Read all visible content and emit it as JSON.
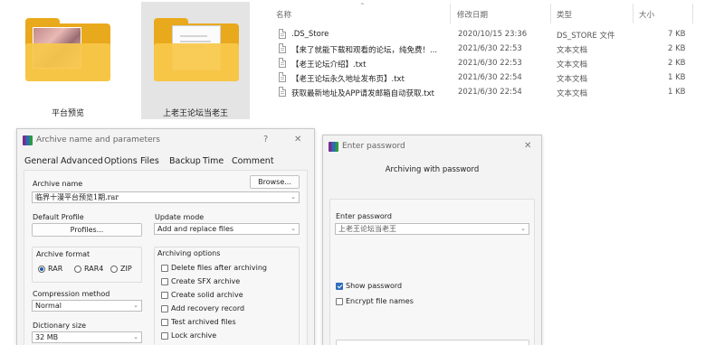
{
  "explorer": {
    "columns": {
      "name": "名称",
      "modified": "修改日期",
      "type": "类型",
      "size": "大小"
    },
    "files": [
      {
        "name": ".DS_Store",
        "date": "2020/10/15 23:36",
        "type": "DS_STORE 文件",
        "size": "7 KB"
      },
      {
        "name": "【来了就能下载和观看的论坛，纯免费！...",
        "date": "2021/6/30 22:53",
        "type": "文本文档",
        "size": "2 KB"
      },
      {
        "name": "【老王论坛介绍】.txt",
        "date": "2021/6/30 22:53",
        "type": "文本文档",
        "size": "2 KB"
      },
      {
        "name": "【老王论坛永久地址发布页】.txt",
        "date": "2021/6/30 22:54",
        "type": "文本文档",
        "size": "1 KB"
      },
      {
        "name": "获取最新地址及APP请发邮箱自动获取.txt",
        "date": "2021/6/30 22:54",
        "type": "文本文档",
        "size": "1 KB"
      }
    ]
  },
  "folders": [
    {
      "label": "平台预览"
    },
    {
      "label": "上老王论坛当老王"
    }
  ],
  "archive_dialog": {
    "title": "Archive name and parameters",
    "help": "?",
    "close": "✕",
    "tabs": [
      "General",
      "Advanced",
      "Options",
      "Files",
      "Backup",
      "Time",
      "Comment"
    ],
    "archive_name_label": "Archive name",
    "browse_label": "Browse...",
    "archive_name_value": "临界十漫平台预览1期.rar",
    "default_profile_label": "Default Profile",
    "profiles_label": "Profiles...",
    "update_mode_label": "Update mode",
    "update_mode_value": "Add and replace files",
    "archive_format_label": "Archive format",
    "formats": [
      "RAR",
      "RAR4",
      "ZIP"
    ],
    "selected_format": "RAR",
    "compression_method_label": "Compression method",
    "compression_method_value": "Normal",
    "dictionary_size_label": "Dictionary size",
    "dictionary_size_value": "32 MB",
    "archiving_options_label": "Archiving options",
    "options": [
      {
        "label": "Delete files after archiving",
        "checked": false
      },
      {
        "label": "Create SFX archive",
        "checked": false
      },
      {
        "label": "Create solid archive",
        "checked": false
      },
      {
        "label": "Add recovery record",
        "checked": false
      },
      {
        "label": "Test archived files",
        "checked": false
      },
      {
        "label": "Lock archive",
        "checked": false
      }
    ]
  },
  "password_dialog": {
    "title": "Enter password",
    "subtitle": "Archiving with password",
    "enter_password_label": "Enter password",
    "password_value": "上老王论坛当老王",
    "show_password_label": "Show password",
    "show_password_checked": true,
    "encrypt_names_label": "Encrypt file names",
    "encrypt_names_checked": false
  }
}
